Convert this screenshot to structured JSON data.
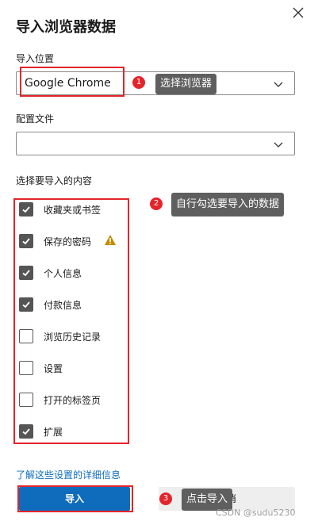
{
  "dialog": {
    "title": "导入浏览器数据",
    "import_from_label": "导入位置",
    "import_from_value": "Google Chrome",
    "profile_label": "配置文件",
    "profile_value": "",
    "choose_label": "选择要导入的内容",
    "items": [
      {
        "label": "收藏夹或书签",
        "checked": true
      },
      {
        "label": "保存的密码",
        "checked": true,
        "warning": true
      },
      {
        "label": "个人信息",
        "checked": true
      },
      {
        "label": "付款信息",
        "checked": true
      },
      {
        "label": "浏览历史记录",
        "checked": false
      },
      {
        "label": "设置",
        "checked": false
      },
      {
        "label": "打开的标签页",
        "checked": false
      },
      {
        "label": "扩展",
        "checked": true
      }
    ],
    "learn_more": "了解这些设置的详细信息",
    "import_button": "导入",
    "cancel_button": "取消"
  },
  "annotations": [
    {
      "number": "1",
      "text": "选择浏览器"
    },
    {
      "number": "2",
      "text": "自行勾选要导入的数据"
    },
    {
      "number": "3",
      "text": "点击导入"
    }
  ],
  "watermark": "CSDN @sudu5230",
  "colors": {
    "accent": "#0f6cbd",
    "annotation_red": "#e3242b",
    "callout_bg": "#5f5f5f",
    "warning": "#c58c00"
  }
}
